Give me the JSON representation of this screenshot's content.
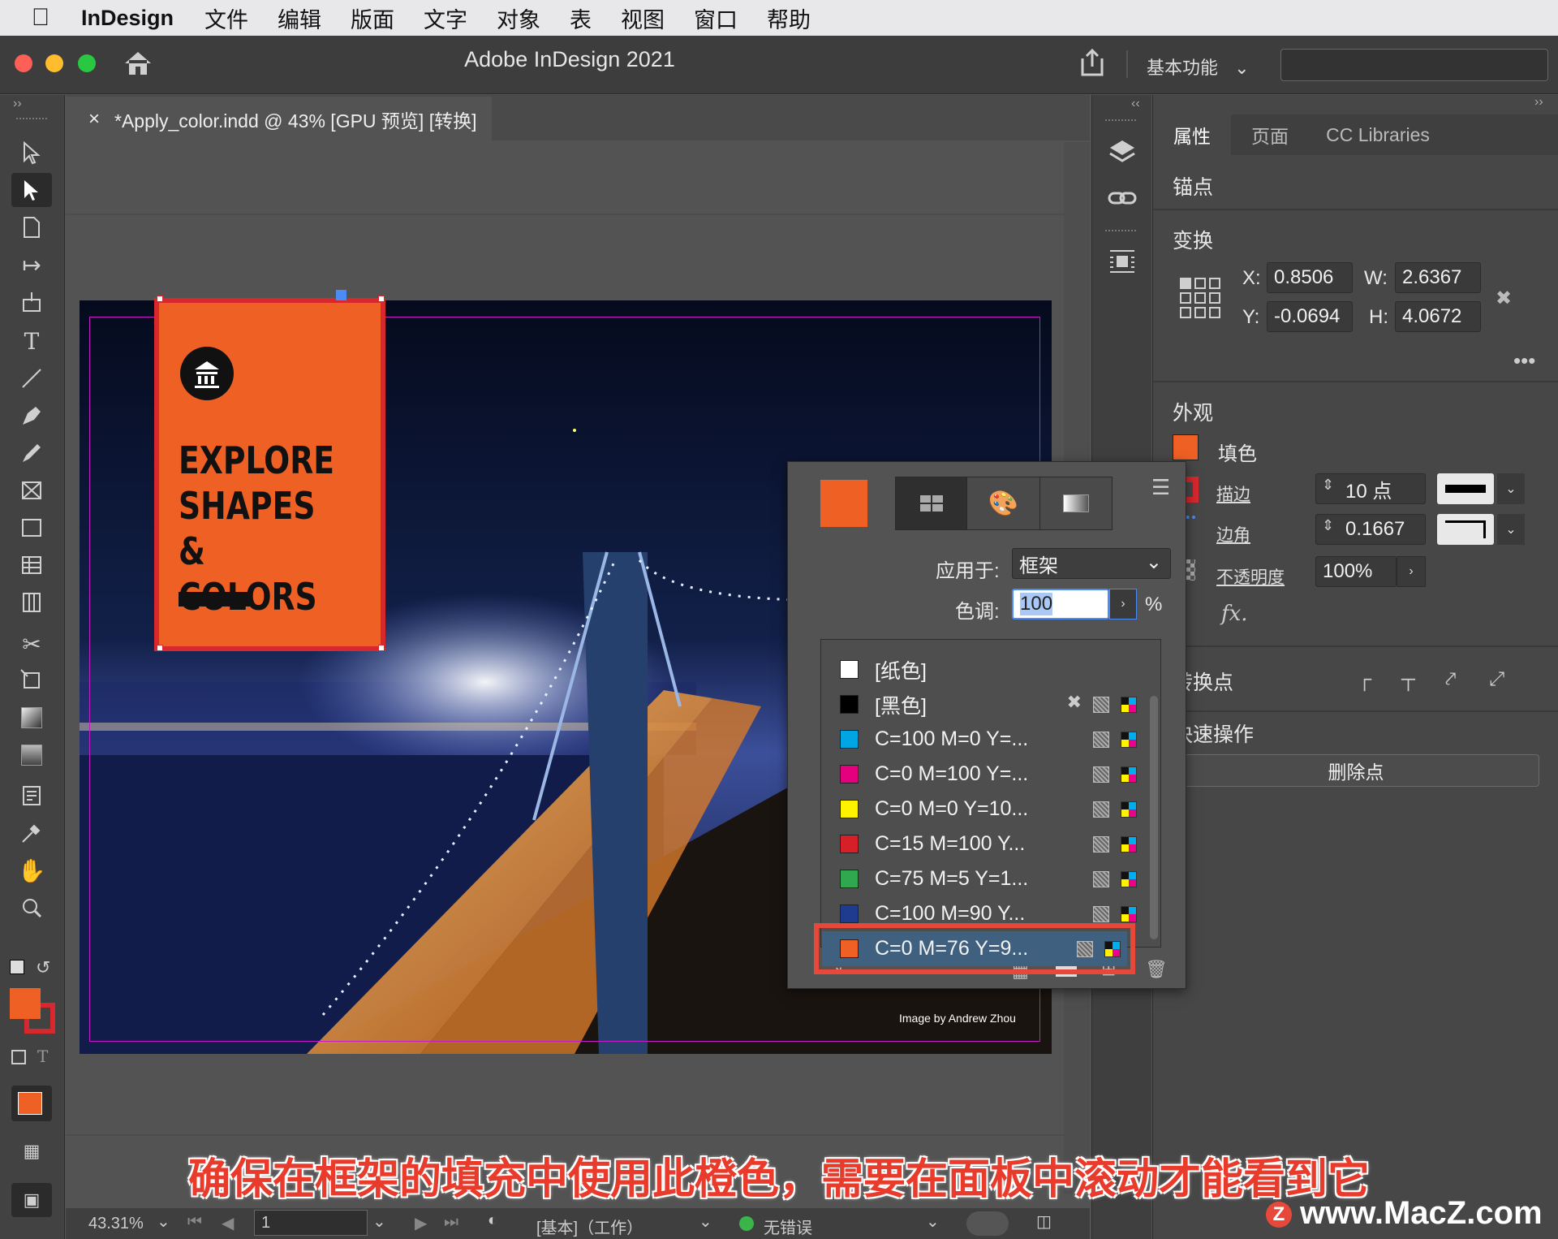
{
  "menubar": {
    "app": "InDesign",
    "items": [
      "文件",
      "编辑",
      "版面",
      "文字",
      "对象",
      "表",
      "视图",
      "窗口",
      "帮助"
    ]
  },
  "window": {
    "title": "Adobe InDesign 2021",
    "workspace": "基本功能"
  },
  "document": {
    "tab_title": "*Apply_color.indd @ 43% [GPU 预览] [转换]",
    "close": "×"
  },
  "poster": {
    "line1": "EXPLORE",
    "line2": "SHAPES &",
    "line3": "COLORS",
    "credit": "Image by Andrew Zhou"
  },
  "status": {
    "zoom": "43.31%",
    "page": "1",
    "profile": "[基本]（工作）",
    "errors": "无错误"
  },
  "properties": {
    "tabs": [
      "属性",
      "页面",
      "CC Libraries"
    ],
    "anchor_title": "锚点",
    "transform_title": "变换",
    "x_label": "X:",
    "x_value": "0.8506",
    "y_label": "Y:",
    "y_value": "-0.0694",
    "w_label": "W:",
    "w_value": "2.6367",
    "h_label": "H:",
    "h_value": "4.0672",
    "appearance_title": "外观",
    "fill_label": "填色",
    "stroke_label": "描边",
    "stroke_value": "10 点",
    "corner_label": "边角",
    "corner_value": "0.1667",
    "opacity_label": "不透明度",
    "opacity_value": "100%",
    "fx": "fx.",
    "convert_title": "转换点",
    "quick_title": "快速操作",
    "delete_point": "删除点"
  },
  "swatches": {
    "apply_label": "应用于:",
    "apply_value": "框架",
    "tint_label": "色调:",
    "tint_value": "100",
    "tint_unit": "%",
    "items": [
      {
        "name": "[纸色]",
        "color": "#ffffff"
      },
      {
        "name": "[黑色]",
        "color": "#000000"
      },
      {
        "name": "C=100 M=0 Y=...",
        "color": "#00a6e3"
      },
      {
        "name": "C=0 M=100 Y=...",
        "color": "#e5007e"
      },
      {
        "name": "C=0 M=0 Y=10...",
        "color": "#fff200"
      },
      {
        "name": "C=15 M=100 Y...",
        "color": "#d71f27"
      },
      {
        "name": "C=75 M=5 Y=1...",
        "color": "#2fa84f"
      },
      {
        "name": "C=100 M=90 Y...",
        "color": "#1f3b8f"
      },
      {
        "name": "C=0 M=76 Y=9...",
        "color": "#ef6025"
      }
    ],
    "selected_index": 8
  },
  "colors": {
    "accent_orange": "#ef6025",
    "frame_red": "#d7282e",
    "highlight_red": "#e8483a"
  },
  "caption": "确保在框架的填充中使用此橙色，需要在面板中滚动才能看到它",
  "watermark": "www.MacZ.com"
}
